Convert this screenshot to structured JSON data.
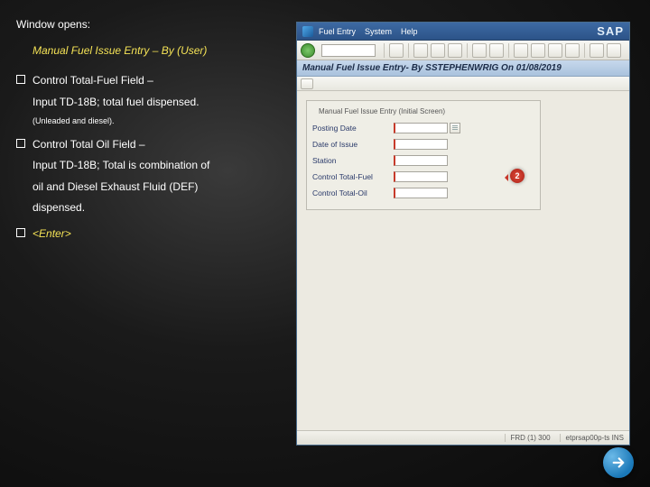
{
  "slide": {
    "intro": "Window opens:",
    "italic_title": "Manual Fuel Issue Entry – By (User)",
    "bullets": [
      {
        "main": "Control Total-Fuel Field –",
        "sub1": "Input TD-18B; total fuel dispensed.",
        "note": "(Unleaded and diesel)."
      },
      {
        "main": "Control Total Oil Field –",
        "sub1": "Input TD-18B; Total is combination of",
        "sub2": "oil and Diesel Exhaust Fluid (DEF)",
        "sub3": "dispensed."
      },
      {
        "main_html": "<Enter>",
        "is_enter": true
      }
    ]
  },
  "sap": {
    "menus": [
      "Fuel Entry",
      "System",
      "Help"
    ],
    "logo": "SAP",
    "banner": "Manual Fuel Issue Entry- By SSTEPHENWRIG On 01/08/2019",
    "group_title": "Manual Fuel Issue Entry (Initial Screen)",
    "fields": [
      {
        "label": "Posting Date",
        "required": true,
        "date_picker": true
      },
      {
        "label": "Date of Issue",
        "required": true,
        "date_picker": false
      },
      {
        "label": "Station",
        "required": true,
        "date_picker": false
      },
      {
        "label": "Control Total-Fuel",
        "required": true,
        "date_picker": false
      },
      {
        "label": "Control Total-Oil",
        "required": true,
        "date_picker": false
      }
    ],
    "callout": "2",
    "status": {
      "left": "",
      "seg1": "FRD (1) 300",
      "seg2": "etprsap00p-ts   INS"
    }
  },
  "nav": {
    "next": "next"
  }
}
